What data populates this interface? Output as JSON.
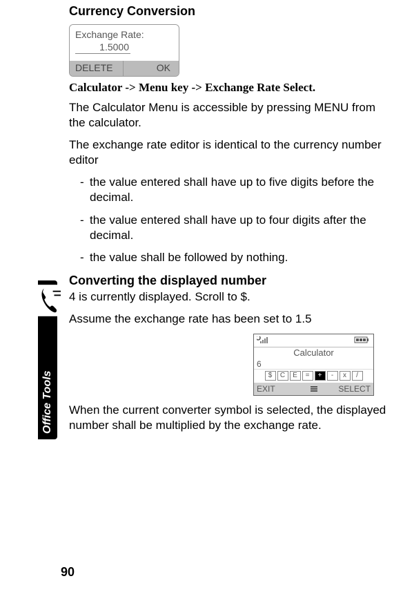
{
  "heading": "Currency Conversion",
  "exchangeScreen": {
    "label": "Exchange Rate:",
    "value": "1.5000",
    "leftSoft": "DELETE",
    "rightSoft": "OK"
  },
  "navPath": "Calculator -> Menu key -> Exchange Rate Select.",
  "para1": "The Calculator Menu is accessible by pressing MENU from the calculator.",
  "para2": "The exchange rate editor is identical to the currency number editor",
  "bullets": {
    "0": "the value entered shall have up to five digits before the decimal.",
    "1": "the value entered shall have up to four digits after the decimal.",
    "2": "the value shall be followed by nothing."
  },
  "subHeading": "Converting the displayed number",
  "para3": "4 is currently displayed. Scroll to $.",
  "para4": "Assume the exchange rate has been set to 1.5",
  "calcScreen": {
    "title": "Calculator",
    "display": "6",
    "ops": {
      "0": "$",
      "1": "C",
      "2": "E",
      "3": "=",
      "4": "+",
      "5": "-",
      "6": "x",
      "7": "/"
    },
    "leftSoft": "EXIT",
    "rightSoft": "SELECT"
  },
  "para5": "When the current converter symbol is selected, the displayed number shall be multiplied by the exchange rate.",
  "sideTab": "Office Tools",
  "pageNumber": "90"
}
